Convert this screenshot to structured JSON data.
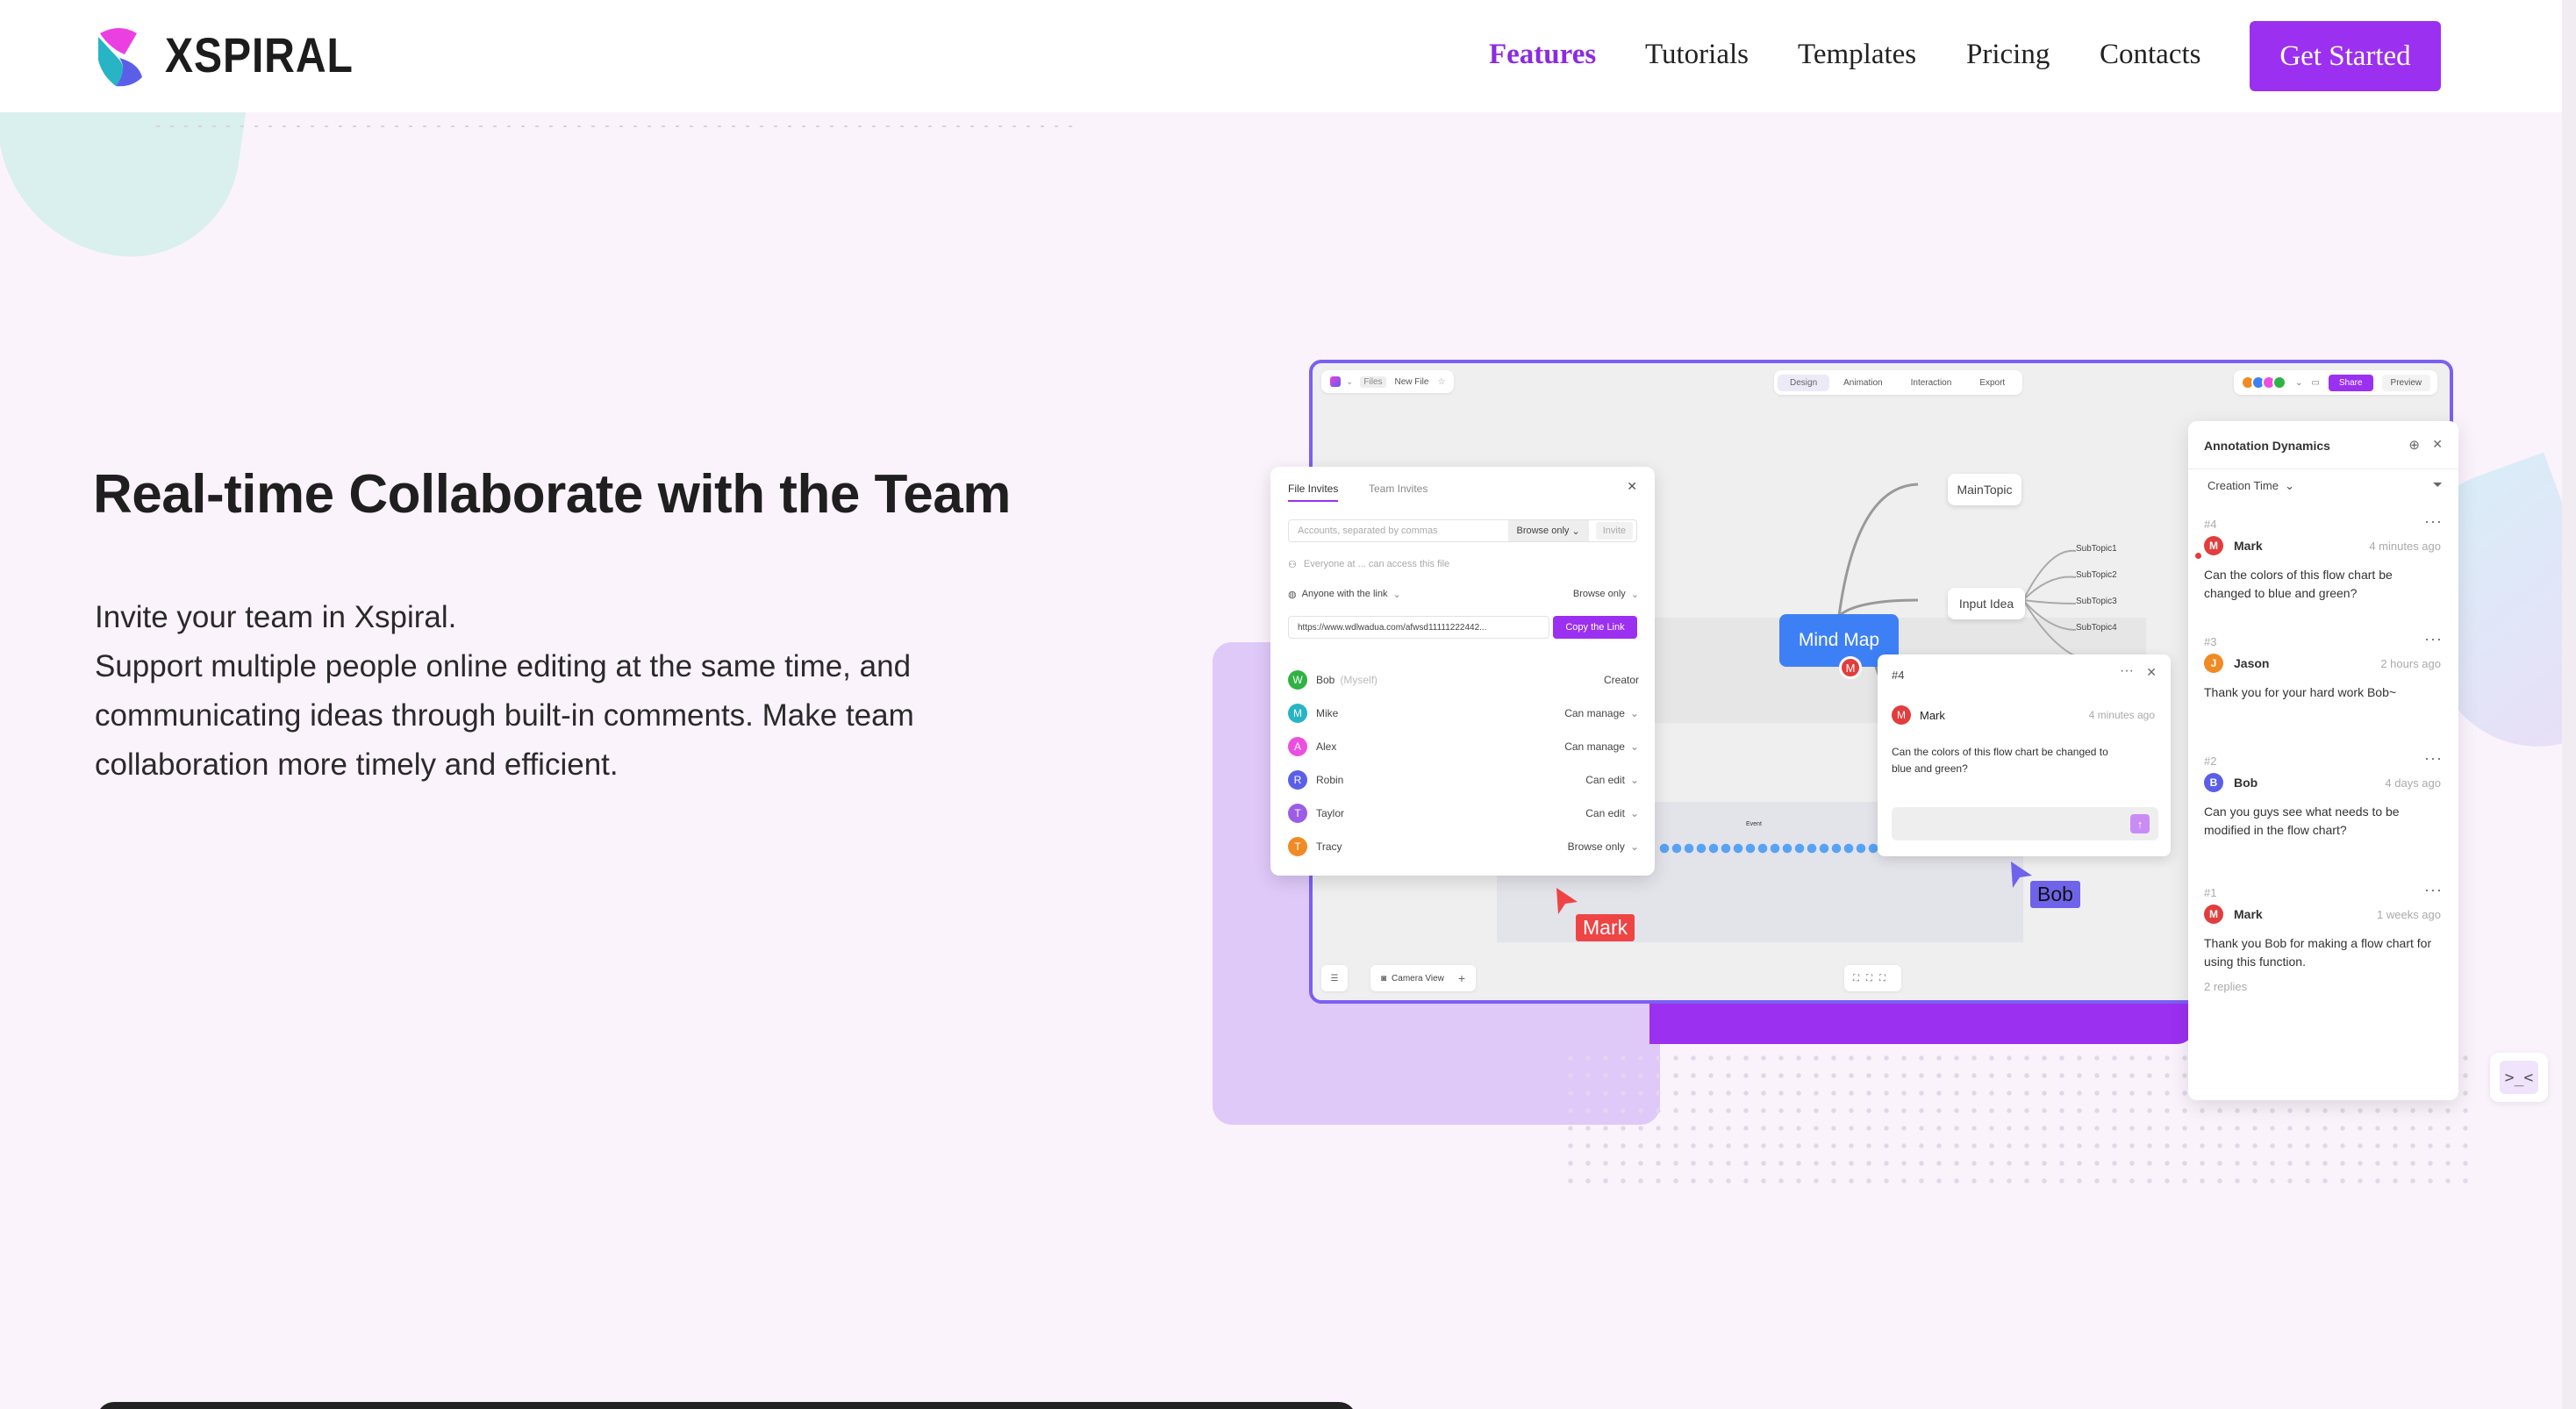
{
  "brand": {
    "name": "XSPIRAL"
  },
  "nav": {
    "items": [
      "Features",
      "Tutorials",
      "Templates",
      "Pricing",
      "Contacts"
    ],
    "active": "Features",
    "cta": "Get Started"
  },
  "hero": {
    "title": "Real-time Collaborate with the Team",
    "paragraph": [
      "Invite your team in Xspiral.",
      "Support multiple people online editing at the same time, and",
      "communicating ideas through built-in comments. Make team",
      "collaboration more timely and efficient."
    ]
  },
  "editor": {
    "top_left": {
      "files": "Files",
      "new_file": "New File"
    },
    "tabs": [
      "Design",
      "Animation",
      "Interaction",
      "Export"
    ],
    "active_tab": "Design",
    "share": "Share",
    "preview": "Preview",
    "avatar_colors": [
      "#f08a24",
      "#3d80f6",
      "#ec4fe0",
      "#2fb344"
    ],
    "camera_view": "Camera View",
    "mind_map": {
      "root": "Mind Map",
      "main_topic": "MainTopic",
      "input_idea": "Input Idea",
      "subtopics": [
        "SubTopic1",
        "SubTopic2",
        "SubTopic3",
        "SubTopic4"
      ]
    },
    "cursors": [
      {
        "name": "Mark",
        "color": "#ef4444"
      },
      {
        "name": "Bob",
        "color": "#6f63ea"
      }
    ],
    "comment_card": {
      "id": "#4",
      "author": "Mark",
      "time": "4 minutes ago",
      "text_lines": [
        "Can the colors of this flow chart be changed to",
        "blue and green?"
      ]
    },
    "small_label": "Event"
  },
  "invite_panel": {
    "tabs": [
      "File Invites",
      "Team Invites"
    ],
    "active_tab": "File Invites",
    "accounts_placeholder": "Accounts, separated by commas",
    "browse_only": "Browse only",
    "invite_button": "Invite",
    "everyone_note": "Everyone at ... can access this file",
    "anyone_with_link": "Anyone with the link",
    "link_url": "https://www.wdlwadua.com/afwsd11111222442...",
    "copy_link": "Copy the Link",
    "members": [
      {
        "initial": "W",
        "name": "Bob",
        "tag": "(Myself)",
        "perm": "Creator",
        "color": "#2fb344"
      },
      {
        "initial": "M",
        "name": "Mike",
        "tag": "",
        "perm": "Can manage",
        "color": "#27b4c4"
      },
      {
        "initial": "A",
        "name": "Alex",
        "tag": "",
        "perm": "Can manage",
        "color": "#ec4fe0"
      },
      {
        "initial": "R",
        "name": "Robin",
        "tag": "",
        "perm": "Can edit",
        "color": "#5b5fe8"
      },
      {
        "initial": "T",
        "name": "Taylor",
        "tag": "",
        "perm": "Can edit",
        "color": "#9b5de5"
      },
      {
        "initial": "T",
        "name": "Tracy",
        "tag": "",
        "perm": "Browse only",
        "color": "#f08a24"
      }
    ]
  },
  "annotations": {
    "title": "Annotation Dynamics",
    "sort": "Creation Time",
    "items": [
      {
        "num": "#4",
        "author": "Mark",
        "initial": "M",
        "color": "#e23d3d",
        "time": "4 minutes ago",
        "text": "Can the colors of this flow chart be changed to blue and green?",
        "extra": ""
      },
      {
        "num": "#3",
        "author": "Jason",
        "initial": "J",
        "color": "#f08a24",
        "time": "2 hours ago",
        "text": "Thank you for your hard work Bob~",
        "extra": ""
      },
      {
        "num": "#2",
        "author": "Bob",
        "initial": "B",
        "color": "#5b5fe8",
        "time": "4 days ago",
        "text": "Can you guys see what needs to be modified in the flow chart?",
        "extra": ""
      },
      {
        "num": "#1",
        "author": "Mark",
        "initial": "M",
        "color": "#e23d3d",
        "time": "1 weeks ago",
        "text": "Thank you Bob for making a flow chart for using this function.",
        "extra": "2 replies"
      }
    ]
  },
  "colors": {
    "accent": "#9b30f0",
    "nav_active": "#8a2be2",
    "mind_map": "#3d80f6",
    "page_bg": "#fbf3fb"
  }
}
